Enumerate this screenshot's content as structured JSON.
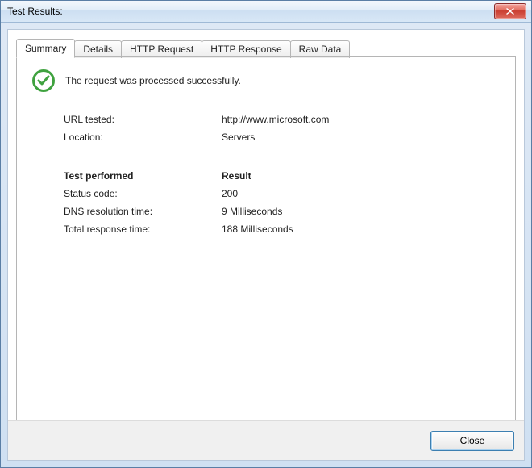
{
  "window": {
    "title": "Test Results:"
  },
  "tabs": {
    "items": [
      {
        "label": "Summary",
        "active": true
      },
      {
        "label": "Details",
        "active": false
      },
      {
        "label": "HTTP Request",
        "active": false
      },
      {
        "label": "HTTP Response",
        "active": false
      },
      {
        "label": "Raw Data",
        "active": false
      }
    ]
  },
  "summary": {
    "status_message": "The request was processed successfully.",
    "status_kind": "success",
    "rows_top": [
      {
        "label": "URL tested:",
        "value": "http://www.microsoft.com"
      },
      {
        "label": "Location:",
        "value": "Servers"
      }
    ],
    "section_header": {
      "left": "Test performed",
      "right": "Result"
    },
    "rows_bottom": [
      {
        "label": "Status code:",
        "value": "200"
      },
      {
        "label": "DNS resolution time:",
        "value": "9 Milliseconds"
      },
      {
        "label": "Total response time:",
        "value": "188 Milliseconds"
      }
    ]
  },
  "footer": {
    "close_label": "Close"
  }
}
